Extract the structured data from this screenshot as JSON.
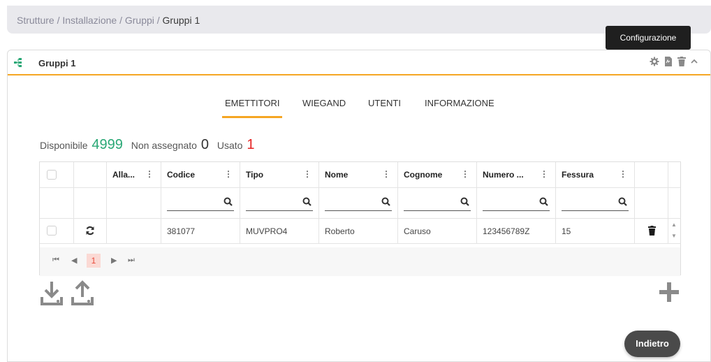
{
  "breadcrumb": {
    "path": "Strutture / Installazione / Gruppi / ",
    "current": "Gruppi 1"
  },
  "tooltip": {
    "text": "Configurazione"
  },
  "card": {
    "title": "Gruppi 1"
  },
  "tabs": [
    {
      "label": "EMETTITORI",
      "active": true
    },
    {
      "label": "WIEGAND",
      "active": false
    },
    {
      "label": "UTENTI",
      "active": false
    },
    {
      "label": "INFORMAZIONE",
      "active": false
    }
  ],
  "counters": {
    "available_label": "Disponibile",
    "available_value": "4999",
    "unassigned_label": "Non assegnato",
    "unassigned_value": "0",
    "used_label": "Usato",
    "used_value": "1"
  },
  "table": {
    "columns": [
      "Alla...",
      "Codice",
      "Tipo",
      "Nome",
      "Cognome",
      "Numero ...",
      "Fessura"
    ],
    "rows": [
      {
        "codice": "381077",
        "tipo": "MUVPRO4",
        "nome": "Roberto",
        "cognome": "Caruso",
        "numero": "123456789Z",
        "fessura": "15"
      }
    ],
    "pager": {
      "current_page": "1"
    }
  },
  "buttons": {
    "back_label": "Indietro"
  },
  "colors": {
    "accent": "#f5a623",
    "green": "#2aa876",
    "red": "#e52222"
  }
}
